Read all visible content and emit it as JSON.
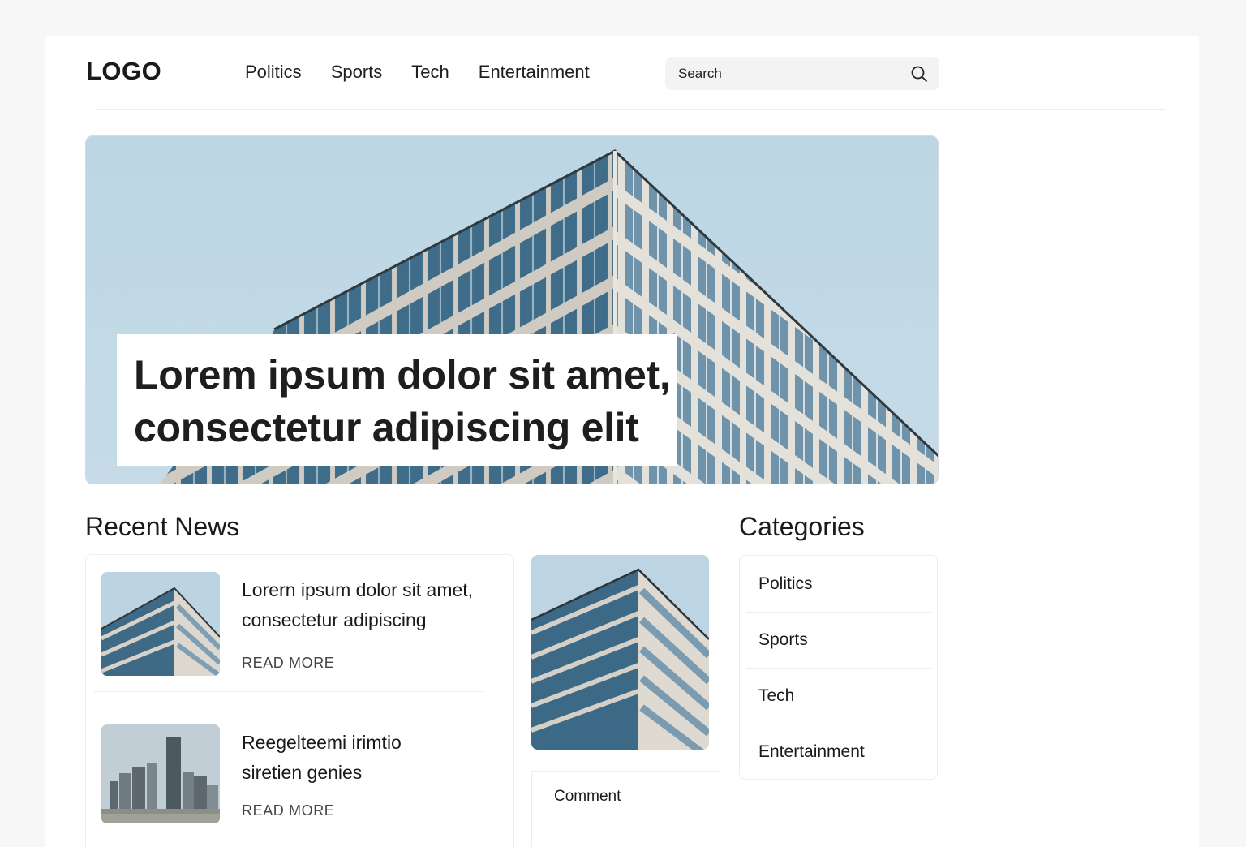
{
  "header": {
    "logo": "LOGO",
    "nav": [
      "Politics",
      "Sports",
      "Tech",
      "Entertainment"
    ],
    "search_placeholder": "Search"
  },
  "hero": {
    "title_line1": "Lorem ipsum dolor sit amet,",
    "title_line2": "consectetur adipiscing elit"
  },
  "recent_news": {
    "heading": "Recent News",
    "items": [
      {
        "title_line1": "Lorern ipsum dolor sit amet,",
        "title_line2": "consectetur adipiscing",
        "cta": "READ MORE"
      },
      {
        "title_line1": "Reegelteemi irimtio",
        "title_line2": "siretien genies",
        "cta": "READ MORE"
      }
    ],
    "side_card_action": "Comment"
  },
  "categories": {
    "heading": "Categories",
    "items": [
      "Politics",
      "Sports",
      "Tech",
      "Entertainment"
    ]
  },
  "icons": [
    "search-icon"
  ],
  "colors": {
    "sky": "#bcd6e4",
    "glass": "#3d6b87",
    "frame": "#d9d6cf",
    "text": "#1a1a1a"
  }
}
